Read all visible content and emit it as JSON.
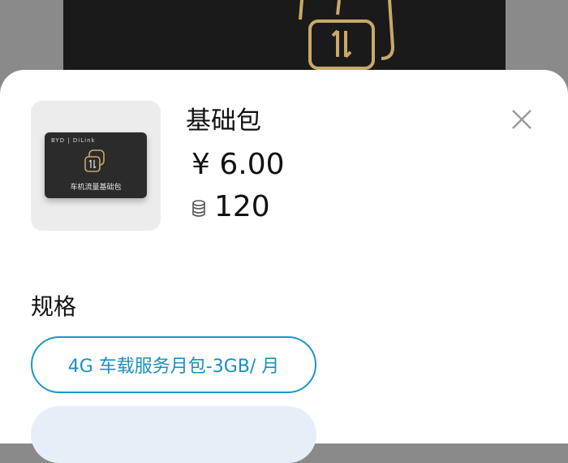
{
  "product": {
    "title": "基础包",
    "price": "¥ 6.00",
    "coins": "120",
    "card_brand": "BYD | DiLink",
    "card_label": "车机流量基础包"
  },
  "spec": {
    "label": "规格",
    "options": [
      {
        "label": "4G 车载服务月包-3GB/ 月",
        "selected": true
      },
      {
        "label": "",
        "selected": false
      }
    ]
  },
  "colors": {
    "accent": "#1a96c9",
    "option_bg": "#e6eef7",
    "overlay": "#8a8a8a"
  }
}
